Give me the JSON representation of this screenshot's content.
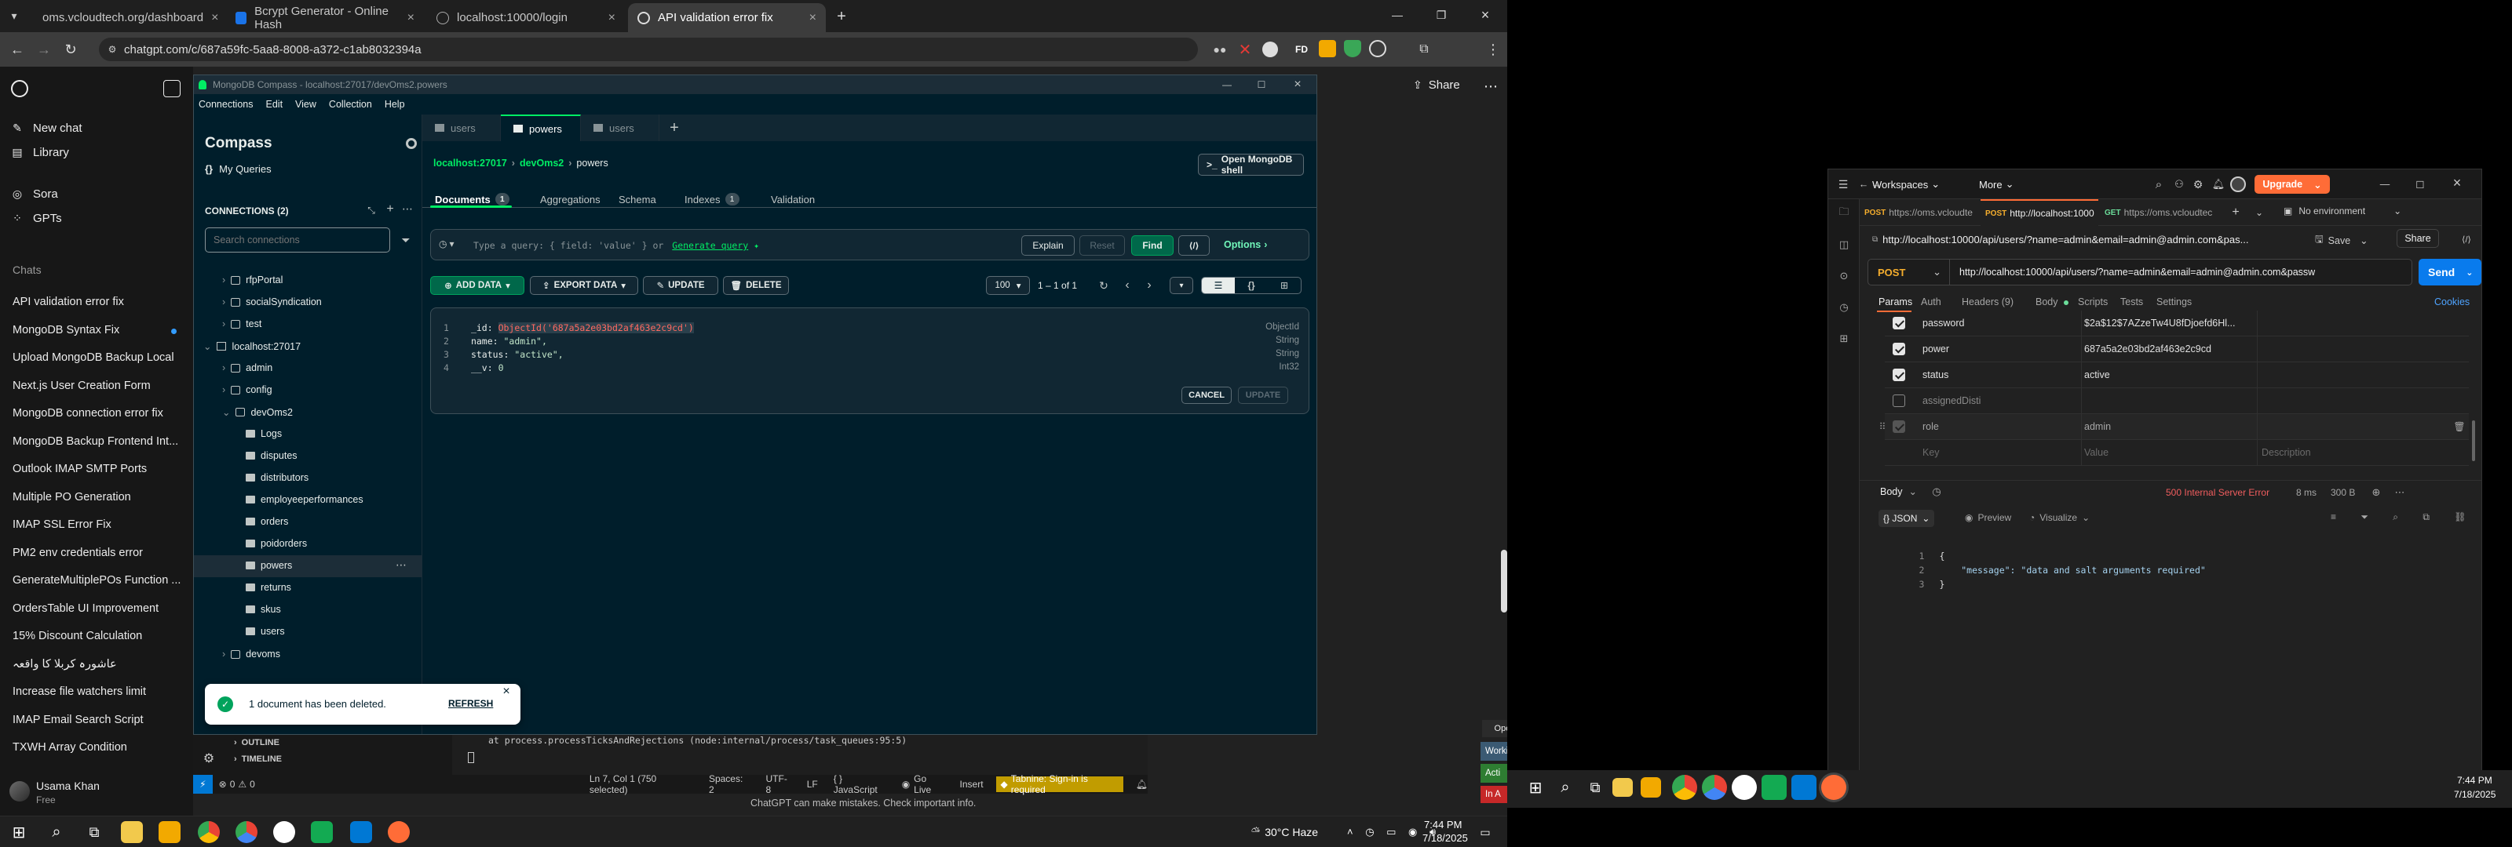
{
  "browser": {
    "tabs": [
      {
        "label": "oms.vcloudtech.org/dashboard"
      },
      {
        "label": "Bcrypt Generator - Online Hash"
      },
      {
        "label": "localhost:10000/login"
      },
      {
        "label": "API validation error fix"
      }
    ],
    "url": "chatgpt.com/c/687a59fc-5aa8-8008-a372-c1ab8032394a",
    "profile_initials": "FD"
  },
  "chatgpt": {
    "new_chat": "New chat",
    "library": "Library",
    "sora": "Sora",
    "gpts": "GPTs",
    "chats_heading": "Chats",
    "chats": [
      "API validation error fix",
      "MongoDB Syntax Fix",
      "Upload MongoDB Backup Local",
      "Next.js User Creation Form",
      "MongoDB connection error fix",
      "MongoDB Backup Frontend Int...",
      "Outlook IMAP SMTP Ports",
      "Multiple PO Generation",
      "IMAP SSL Error Fix",
      "PM2 env credentials error",
      "GenerateMultiplePOs Function ...",
      "OrdersTable UI Improvement",
      "15% Discount Calculation",
      "عاشورہ کربلا کا واقعہ",
      "Increase file watchers limit",
      "IMAP Email Search Script",
      "TXWH Array Condition"
    ],
    "user_name": "Usama Khan",
    "user_plan": "Free",
    "share_label": "Share",
    "disclaimer": "ChatGPT can make mistakes. Check important info."
  },
  "compass": {
    "window_title": "MongoDB Compass - localhost:27017/devOms2.powers",
    "menu": [
      "Connections",
      "Edit",
      "View",
      "Collection",
      "Help"
    ],
    "app_name": "Compass",
    "my_queries": "My Queries",
    "connections_label": "CONNECTIONS (2)",
    "search_placeholder": "Search connections",
    "tree": {
      "db1": "rfpPortal",
      "db2": "socialSyndication",
      "db3": "test",
      "conn": "localhost:27017",
      "db4": "admin",
      "db5": "config",
      "db6": "devOms2",
      "collections": [
        "Logs",
        "disputes",
        "distributors",
        "employeeperformances",
        "orders",
        "poidorders",
        "powers",
        "returns",
        "skus",
        "users"
      ],
      "db7": "devoms"
    },
    "tabs": [
      "users",
      "powers",
      "users"
    ],
    "breadcrumb": {
      "host": "localhost:27017",
      "db": "devOms2",
      "coll": "powers"
    },
    "shell_button": "Open MongoDB shell",
    "subtabs": {
      "documents": "Documents",
      "documents_count": "1",
      "aggregations": "Aggregations",
      "schema": "Schema",
      "indexes": "Indexes",
      "indexes_count": "1",
      "validation": "Validation"
    },
    "query_placeholder": "Type a query: { field: 'value' } or",
    "generate_query": "Generate query",
    "explain": "Explain",
    "reset": "Reset",
    "find": "Find",
    "options": "Options",
    "add_data": "ADD DATA",
    "export_data": "EXPORT DATA",
    "update": "UPDATE",
    "delete": "DELETE",
    "page_size": "100",
    "range": "1 – 1 of 1",
    "document": {
      "lines": [
        {
          "num": "1",
          "key": "_id",
          "value": "ObjectId('687a5a2e03bd2af463e2c9cd')",
          "type": "ObjectId"
        },
        {
          "num": "2",
          "key": "name",
          "value": "\"admin\",",
          "type": "String"
        },
        {
          "num": "3",
          "key": "status",
          "value": "\"active\",",
          "type": "String"
        },
        {
          "num": "4",
          "key": "__v",
          "value": "0",
          "type": "Int32"
        }
      ]
    },
    "cancel": "CANCEL",
    "update_doc": "UPDATE",
    "toast": "1 document has been deleted.",
    "toast_action": "REFRESH"
  },
  "vscode": {
    "outline": "OUTLINE",
    "timeline": "TIMELINE",
    "terminal_line": "at process.processTicksAndRejections (node:internal/process/task_queues:95:5)",
    "status": {
      "errors": "0",
      "warnings": "0",
      "position": "Ln 7, Col 1 (750 selected)",
      "spaces": "Spaces: 2",
      "encoding": "UTF-8",
      "eol": "LF",
      "language": "{ } JavaScript",
      "golive": "Go Live",
      "insert": "Insert",
      "tabnine": "Tabnine: Sign-in is required"
    }
  },
  "floating": {
    "open_app": "Open App",
    "working_status": "Working Status: Active",
    "active": "Acti",
    "in": "In A"
  },
  "taskbar1": {
    "weather": "30°C  Haze",
    "time": "7:44 PM",
    "date": "7/18/2025"
  },
  "postman": {
    "workspaces": "Workspaces",
    "more": "More",
    "upgrade": "Upgrade",
    "tabs": [
      {
        "method": "POST",
        "label": "https://oms.vcloudte"
      },
      {
        "method": "POST",
        "label": "http://localhost:1000"
      },
      {
        "method": "GET",
        "label": "https://oms.vcloudtec"
      }
    ],
    "environment": "No environment",
    "request_title": "http://localhost:10000/api/users/?name=admin&email=admin@admin.com&pas...",
    "save": "Save",
    "share": "Share",
    "method": "POST",
    "url": "http://localhost:10000/api/users/?name=admin&email=admin@admin.com&passw",
    "send": "Send",
    "req_tabs": {
      "params": "Params",
      "auth": "Auth",
      "headers": "Headers (9)",
      "body": "Body",
      "scripts": "Scripts",
      "tests": "Tests",
      "settings": "Settings",
      "cookies": "Cookies"
    },
    "params": [
      {
        "key": "password",
        "value": "$2a$12$7AZzeTw4U8fDjoefd6Hl...",
        "checked": true
      },
      {
        "key": "power",
        "value": "687a5a2e03bd2af463e2c9cd",
        "checked": true
      },
      {
        "key": "status",
        "value": "active",
        "checked": true
      },
      {
        "key": "assignedDisti",
        "value": "",
        "checked": false
      },
      {
        "key": "role",
        "value": "admin",
        "checked": true
      }
    ],
    "placeholder_key": "Key",
    "placeholder_value": "Value",
    "placeholder_desc": "Description",
    "resp_body": "Body",
    "status": "500 Internal Server Error",
    "time": "8 ms",
    "size": "300 B",
    "format": "{} JSON",
    "preview": "Preview",
    "visualize": "Visualize",
    "response_lines": [
      {
        "num": "1",
        "text": "{"
      },
      {
        "num": "2",
        "text": "    \"message\": \"data and salt arguments required\""
      },
      {
        "num": "3",
        "text": "}"
      }
    ]
  },
  "taskbar2": {
    "time": "7:44 PM",
    "date": "7/18/2025"
  },
  "colors": {
    "compass_bg": "#001e2b",
    "mongo_green": "#00ed64",
    "postman_orange": "#ff6c37",
    "send_blue": "#097bed",
    "error_red": "#f05d5e"
  }
}
